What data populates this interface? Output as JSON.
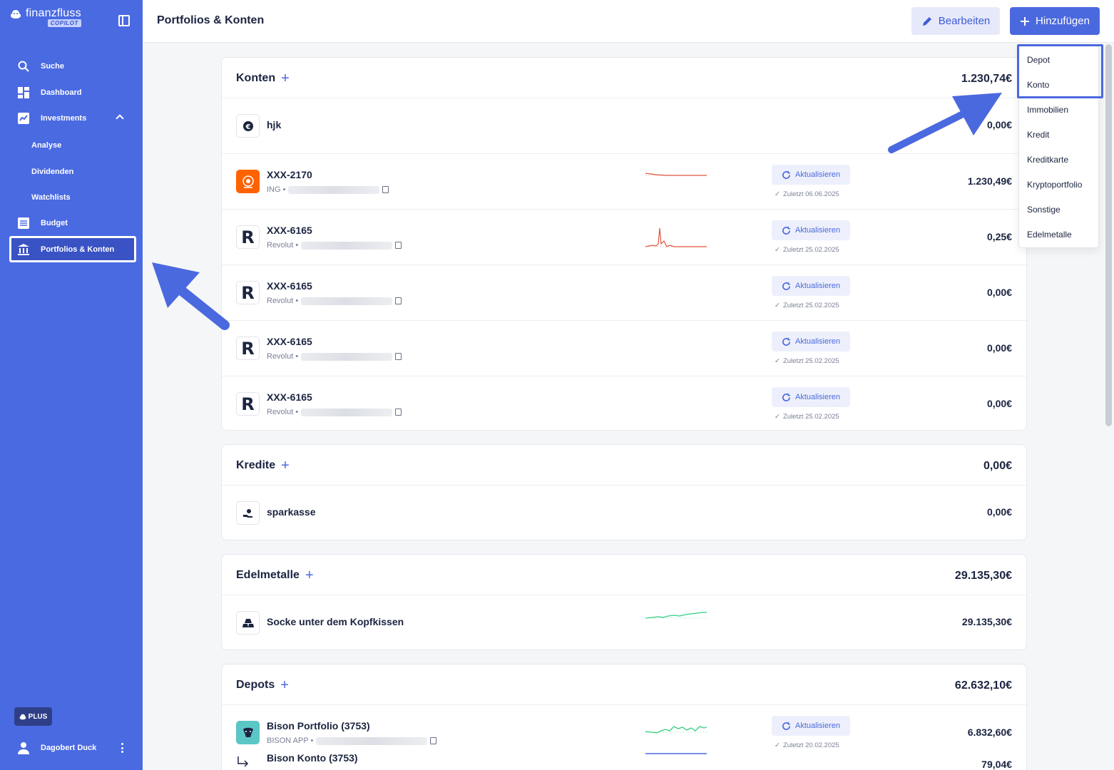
{
  "sidebar": {
    "brand": "finanzfluss",
    "brand_badge": "COPILOT",
    "items": [
      {
        "label": "Suche"
      },
      {
        "label": "Dashboard"
      },
      {
        "label": "Investments"
      },
      {
        "label": "Analyse"
      },
      {
        "label": "Dividenden"
      },
      {
        "label": "Watchlists"
      },
      {
        "label": "Budget"
      },
      {
        "label": "Portfolios & Konten"
      }
    ],
    "plan_badge": "PLUS",
    "user_name": "Dagobert Duck"
  },
  "header": {
    "title": "Portfolios & Konten",
    "edit_label": "Bearbeiten",
    "add_label": "Hinzufügen"
  },
  "add_menu": [
    "Depot",
    "Konto",
    "Immobilien",
    "Kredit",
    "Kreditkarte",
    "Kryptoportfolio",
    "Sonstige",
    "Edelmetalle"
  ],
  "konten": {
    "title": "Konten",
    "total": "1.230,74€",
    "rows": [
      {
        "name": "hjk",
        "amount": "0,00€"
      },
      {
        "name": "XXX-2170",
        "bank": "ING •",
        "amount": "1.230,49€",
        "refresh": "Aktualisieren",
        "updated": "Zuletzt 06.06.2025"
      },
      {
        "name": "XXX-6165",
        "bank": "Revolut •",
        "amount": "0,25€",
        "refresh": "Aktualisieren",
        "updated": "Zuletzt 25.02.2025"
      },
      {
        "name": "XXX-6165",
        "bank": "Revolut •",
        "amount": "0,00€",
        "refresh": "Aktualisieren",
        "updated": "Zuletzt 25.02.2025"
      },
      {
        "name": "XXX-6165",
        "bank": "Revolut •",
        "amount": "0,00€",
        "refresh": "Aktualisieren",
        "updated": "Zuletzt 25.02.2025"
      },
      {
        "name": "XXX-6165",
        "bank": "Revolut •",
        "amount": "0,00€",
        "refresh": "Aktualisieren",
        "updated": "Zuletzt 25.02.2025"
      }
    ]
  },
  "kredite": {
    "title": "Kredite",
    "total": "0,00€",
    "rows": [
      {
        "name": "sparkasse",
        "amount": "0,00€"
      }
    ]
  },
  "edelmetalle": {
    "title": "Edelmetalle",
    "total": "29.135,30€",
    "rows": [
      {
        "name": "Socke unter dem Kopfkissen",
        "amount": "29.135,30€"
      }
    ]
  },
  "depots": {
    "title": "Depots",
    "total": "62.632,10€",
    "rows": [
      {
        "name": "Bison Portfolio (3753)",
        "bank": "BISON APP •",
        "amount": "6.832,60€",
        "refresh": "Aktualisieren",
        "updated": "Zuletzt 20.02.2025"
      },
      {
        "name": "Bison Konto (3753)",
        "amount": "79,04€"
      }
    ]
  },
  "colors": {
    "sidebar": "#4a6ae2",
    "accent": "#4b69de",
    "spark_red": "#e2533f",
    "spark_green": "#2fcf7e"
  }
}
